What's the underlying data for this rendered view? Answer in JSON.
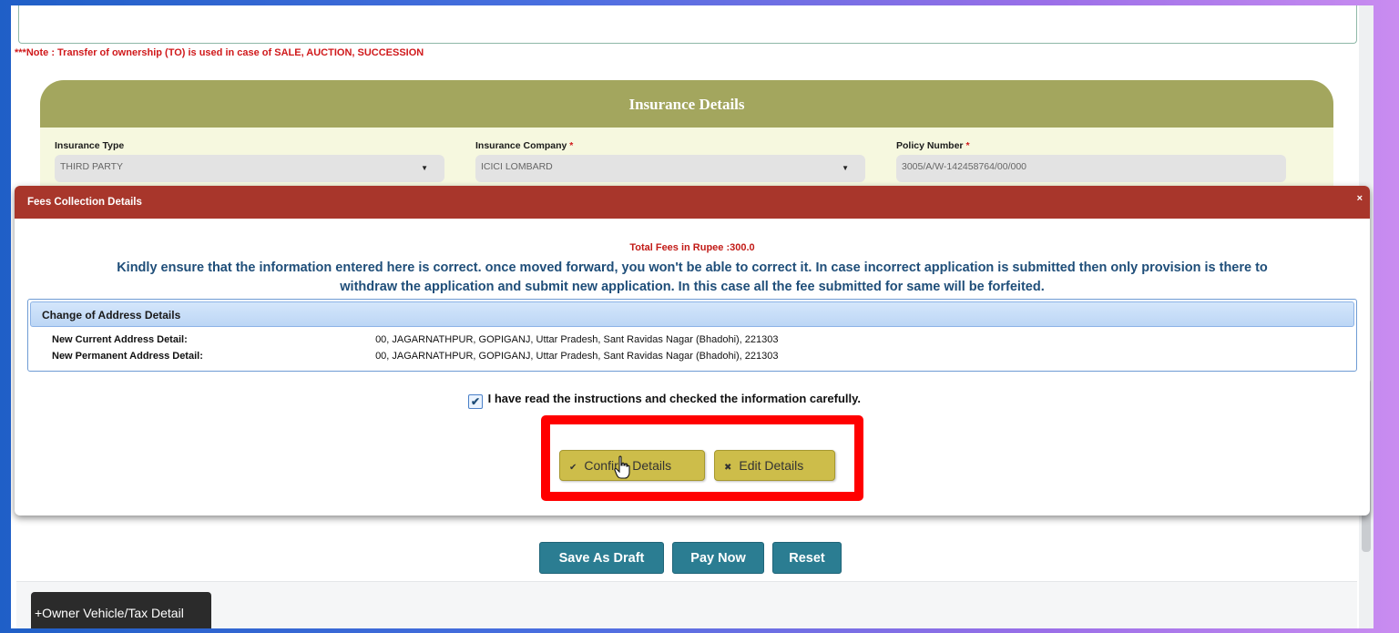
{
  "note": "***Note : Transfer of ownership (TO) is used in case of SALE, AUCTION, SUCCESSION",
  "insurance": {
    "title": "Insurance Details",
    "type_label": "Insurance Type",
    "type_value": "THIRD PARTY",
    "company_label": "Insurance Company",
    "company_value": "ICICI LOMBARD",
    "policy_label": "Policy Number",
    "policy_value": "3005/A/W-142458764/00/000",
    "required_mark": "*"
  },
  "modal": {
    "title": "Fees Collection Details",
    "close": "×",
    "total_fees": "Total Fees in Rupee :300.0",
    "warning_line1": "Kindly ensure that the information entered here is correct. once moved forward, you won't be able to correct it. In case incorrect application is submitted then only provision is there to",
    "warning_line2": "withdraw the application and submit new application. In this case all the fee submitted for same will be forfeited.",
    "address_section": {
      "title": "Change of Address Details",
      "current_label": "New Current Address Detail:",
      "current_value": "00, JAGARNATHPUR, GOPIGANJ, Uttar Pradesh, Sant Ravidas Nagar (Bhadohi), 221303",
      "permanent_label": "New Permanent Address Detail:",
      "permanent_value": "00, JAGARNATHPUR, GOPIGANJ, Uttar Pradesh, Sant Ravidas Nagar (Bhadohi), 221303"
    },
    "consent_text": "I have read the instructions and checked the information carefully.",
    "consent_checked": true,
    "confirm_label": "Confirm Details",
    "edit_label": "Edit Details",
    "confirm_icon": "check-icon",
    "edit_icon": "x-icon"
  },
  "actions": {
    "save_draft": "Save As Draft",
    "pay_now": "Pay Now",
    "reset": "Reset"
  },
  "owner_tab": "+Owner Vehicle/Tax Detail",
  "colors": {
    "insurance_header": "#a3a65e",
    "modal_header": "#a8362b",
    "action_button": "#2b7d92",
    "modal_button": "#cdbd4a",
    "highlight": "#ff0000"
  }
}
